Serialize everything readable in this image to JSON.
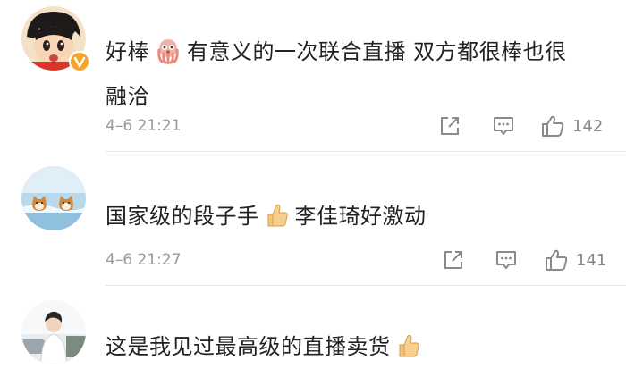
{
  "comments": [
    {
      "avatar": "cartoon-boy-avatar",
      "verified_badge": "verified-v-badge",
      "text_parts": [
        "好棒",
        "有意义的一次联合直播 双方都很棒也很",
        "融洽"
      ],
      "emoji": "octopus-emoji",
      "time": "4–6 21:21",
      "like_count": "142"
    },
    {
      "avatar": "shiba-dogs-avatar",
      "text_parts": [
        "国家级的段子手",
        "李佳琦好激动"
      ],
      "emoji": "thumbs-up-emoji",
      "time": "4–6 21:27",
      "like_count": "141"
    },
    {
      "avatar": "person-photo-avatar",
      "text_parts": [
        "这是我见过最高级的直播卖货"
      ],
      "emoji": "thumbs-up-emoji"
    }
  ],
  "icons": {
    "share": "share-icon",
    "reply": "comment-icon",
    "like": "thumbs-up-icon"
  },
  "colors": {
    "text": "#222222",
    "meta": "#9a9a9a",
    "badge": "#f7a42a",
    "divider": "#e6e6e6"
  }
}
